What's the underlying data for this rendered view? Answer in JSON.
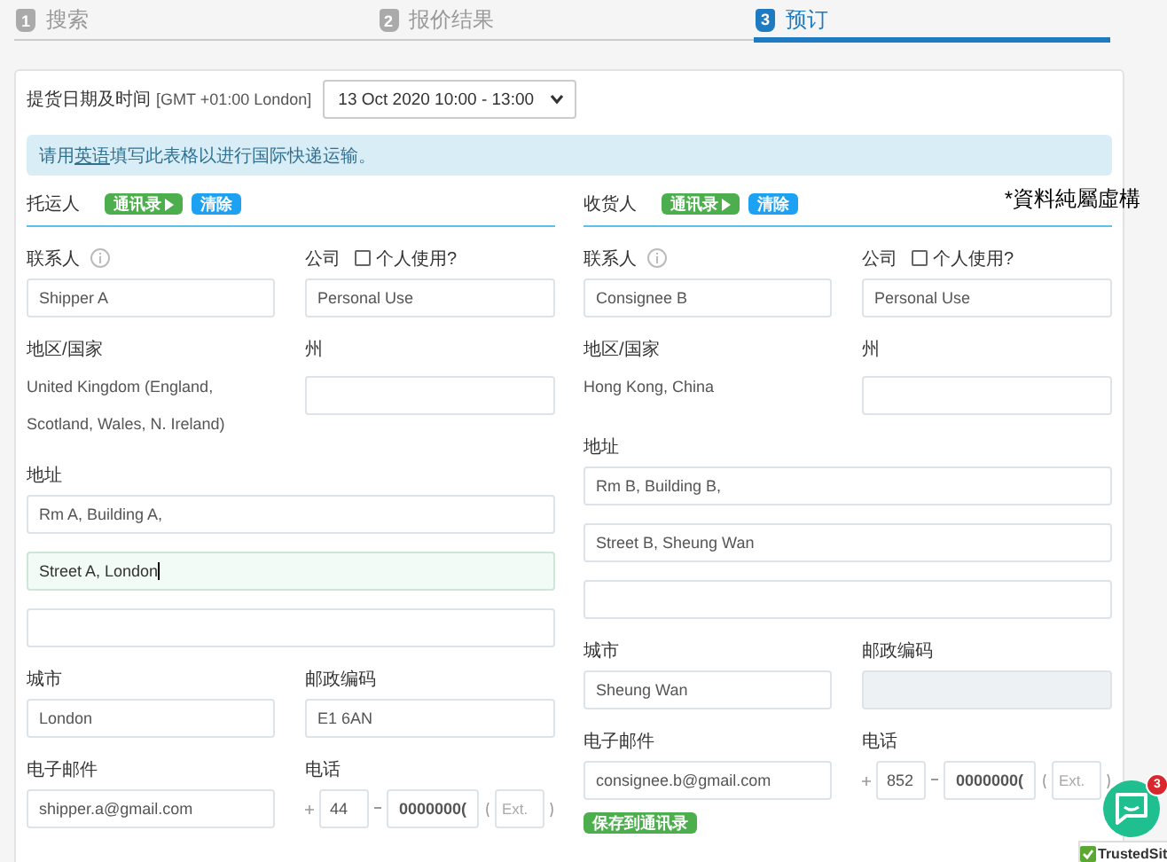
{
  "steps": [
    {
      "number": "1",
      "label": "搜索",
      "selected": false
    },
    {
      "number": "2",
      "label": "报价结果",
      "selected": false
    },
    {
      "number": "3",
      "label": "预订",
      "selected": true
    }
  ],
  "pickup": {
    "label": "提货日期及时间",
    "timezone": "[GMT +01:00 London]",
    "value": "13 Oct 2020 10:00 - 13:00"
  },
  "notice": {
    "before": "请用",
    "link": "英语",
    "after": "填写此表格以进行国际快递运输。"
  },
  "annotation": "*資料純屬虛構",
  "parties": [
    {
      "title": "托运人",
      "contacts_button": "通讯录",
      "clear_button": "清除",
      "contact": {
        "label": "联系人",
        "value": "Shipper A"
      },
      "company": {
        "label": "公司",
        "checkbox_label": "个人使用?",
        "checked": false,
        "value": "Personal Use"
      },
      "country": {
        "label": "地区/国家",
        "value": "United Kingdom (England, Scotland, Wales, N. Ireland)"
      },
      "state": {
        "label": "州"
      },
      "address": {
        "label": "地址",
        "lines": [
          {
            "value": "Rm A, Building A,",
            "focused": false
          },
          {
            "value": "Street A,  London",
            "focused": true
          },
          {
            "focused": false
          }
        ]
      },
      "city": {
        "label": "城市",
        "value": "London"
      },
      "postcode": {
        "label": "邮政编码",
        "value": "E1 6AN",
        "disabled": false
      },
      "email": {
        "label": "电子邮件",
        "value": "shipper.a@gmail.com"
      },
      "phone": {
        "label": "电话",
        "code": "44",
        "number": "0000000(",
        "ext_placeholder": "Ext."
      }
    },
    {
      "title": "收货人",
      "contacts_button": "通讯录",
      "clear_button": "清除",
      "contact": {
        "label": "联系人",
        "value": "Consignee B"
      },
      "company": {
        "label": "公司",
        "checkbox_label": "个人使用?",
        "checked": false,
        "value": "Personal Use"
      },
      "country": {
        "label": "地区/国家",
        "value": "Hong Kong, China"
      },
      "state": {
        "label": "州"
      },
      "address": {
        "label": "地址",
        "lines": [
          {
            "value": "Rm B, Building B,",
            "focused": false
          },
          {
            "value": "Street B, Sheung Wan",
            "focused": false
          },
          {
            "focused": false
          }
        ]
      },
      "city": {
        "label": "城市",
        "value": "Sheung Wan"
      },
      "postcode": {
        "label": "邮政编码",
        "disabled": true
      },
      "email": {
        "label": "电子邮件",
        "value": "consignee.b@gmail.com"
      },
      "phone": {
        "label": "电话",
        "code": "852",
        "number": "0000000(",
        "ext_placeholder": "Ext."
      },
      "save_button": "保存到通讯录"
    }
  ],
  "chat": {
    "badge": "3"
  },
  "trust_badge": "TrustedSit"
}
